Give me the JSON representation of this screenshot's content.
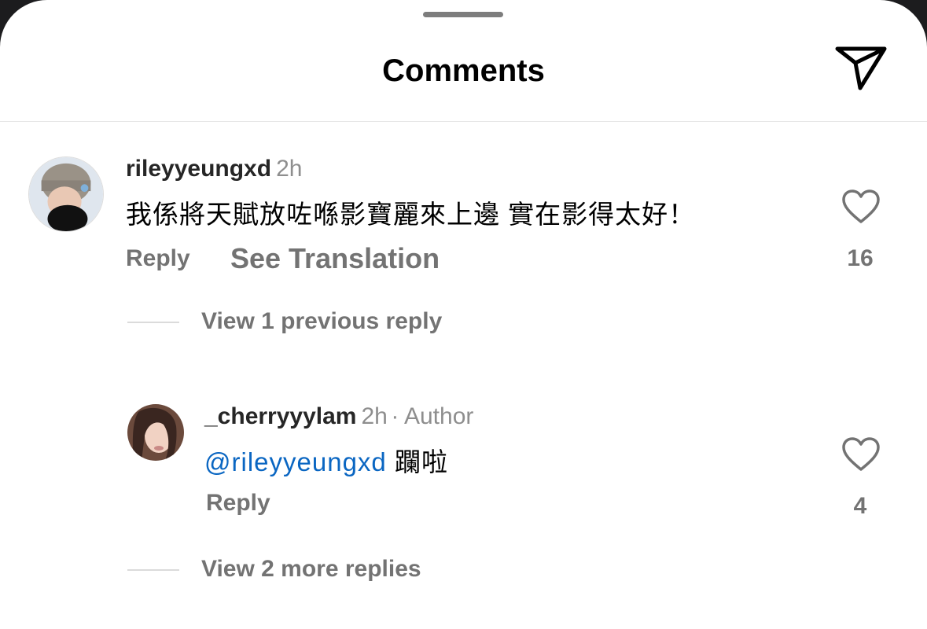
{
  "header": {
    "title": "Comments"
  },
  "comments": [
    {
      "username": "rileyyeungxd",
      "time": "2h",
      "text": "我係將天賦放咗喺影寶麗來上邊 實在影得太好！",
      "reply_label": "Reply",
      "translate_label": "See Translation",
      "likes": "16",
      "view_replies": "View 1 previous reply"
    },
    {
      "username": "_cherryyylam",
      "time": "2h",
      "author_tag": "· Author",
      "mention": "@rileyyeungxd",
      "text": " 躝啦",
      "reply_label": "Reply",
      "likes": "4",
      "view_replies": "View 2 more replies"
    }
  ],
  "icons": {
    "send": "paper-plane-icon",
    "like": "heart-outline-icon"
  },
  "colors": {
    "mention": "#0a66c2",
    "secondary_text": "#737373"
  }
}
